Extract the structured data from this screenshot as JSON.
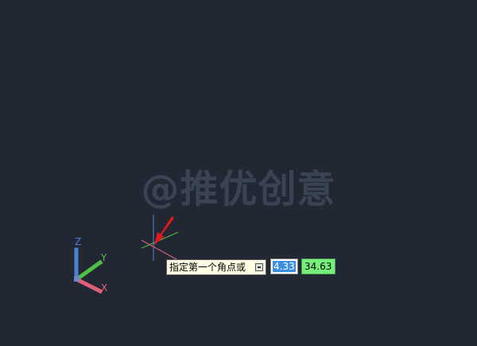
{
  "watermark": {
    "text": "@推优创意"
  },
  "ucs": {
    "x_label": "X",
    "y_label": "Y",
    "z_label": "Z"
  },
  "prompt": {
    "text": "指定第一个角点或",
    "icon": "keyboard-icon"
  },
  "coords": {
    "x_value": "4.33",
    "y_value": "34.63"
  },
  "colors": {
    "background": "#222833",
    "tooltip_bg": "#ffffe6",
    "x_axis": "#e0607a",
    "y_axis": "#4fbf48",
    "z_axis": "#4f7fd0",
    "arrow": "#e0191f",
    "coord_y_bg": "#76f07a",
    "coord_x_selected": "#3b8fe0"
  }
}
